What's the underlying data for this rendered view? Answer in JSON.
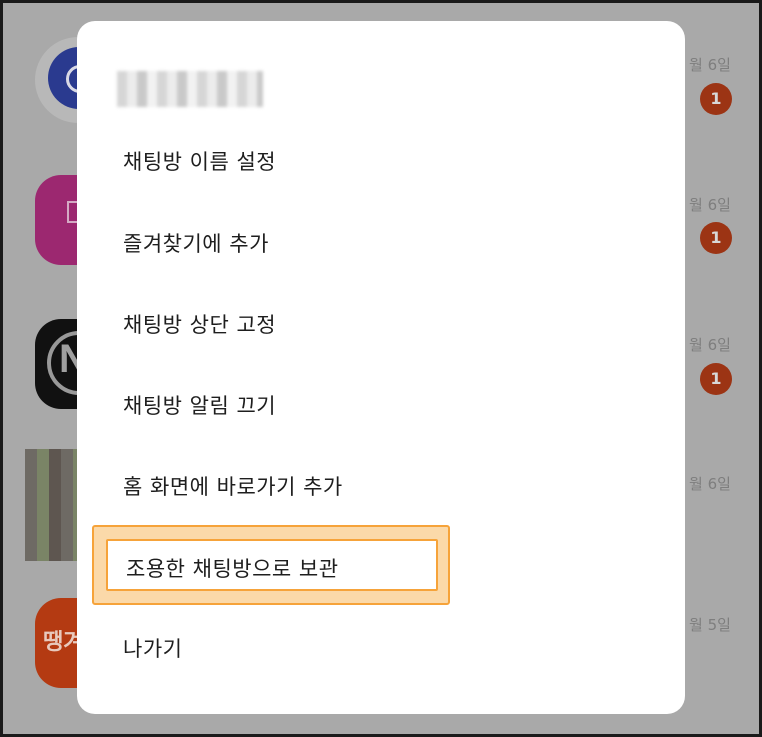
{
  "background": {
    "chats": [
      {
        "date": "월 6일",
        "unread": "1"
      },
      {
        "date": "월 6일",
        "unread": "1"
      },
      {
        "date": "월 6일",
        "unread": "1"
      },
      {
        "date": "월 6일",
        "unread": ""
      },
      {
        "date": "월 5일",
        "unread": ""
      }
    ],
    "avatar_letters": {
      "chat3": "N",
      "chat5": "땡겨"
    }
  },
  "dialog": {
    "title": "",
    "menu_items": [
      "채팅방 이름 설정",
      "즐겨찾기에 추가",
      "채팅방 상단 고정",
      "채팅방 알림 끄기",
      "홈 화면에 바로가기 추가",
      "조용한 채팅방으로 보관",
      "나가기"
    ]
  },
  "colors": {
    "highlight_border": "#f6a33a",
    "highlight_fill": "#fbd9a9",
    "badge": "#9c3414",
    "dim_overlay": "#a9a9a9"
  }
}
